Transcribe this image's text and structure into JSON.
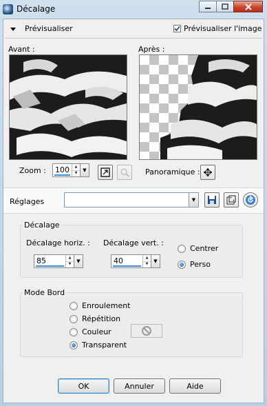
{
  "window": {
    "title": "Décalage"
  },
  "preview_section": {
    "header_label": "Prévisualiser",
    "preview_checkbox_label": "Prévisualiser l'image",
    "preview_checked": true,
    "before_label": "Avant :",
    "after_label": "Après :"
  },
  "zoom": {
    "label": "Zoom :",
    "value": "100"
  },
  "pan": {
    "label": "Panoramique :"
  },
  "presets": {
    "label": "Réglages",
    "value": ""
  },
  "offset": {
    "group_label": "Décalage",
    "horiz_label": "Décalage horiz. :",
    "horiz_value": "85",
    "vert_label": "Décalage vert. :",
    "vert_value": "40",
    "center_label": "Centrer",
    "custom_label": "Perso",
    "selected": "Perso"
  },
  "edge_mode": {
    "group_label": "Mode Bord",
    "options": [
      "Enroulement",
      "Répétition",
      "Couleur",
      "Transparent"
    ],
    "selected": "Transparent"
  },
  "buttons": {
    "ok": "OK",
    "cancel": "Annuler",
    "help": "Aide"
  },
  "colors": {
    "accent": "#3a8be0",
    "dialog_bg": "#f0f0f0",
    "close_red": "#c9462f"
  }
}
